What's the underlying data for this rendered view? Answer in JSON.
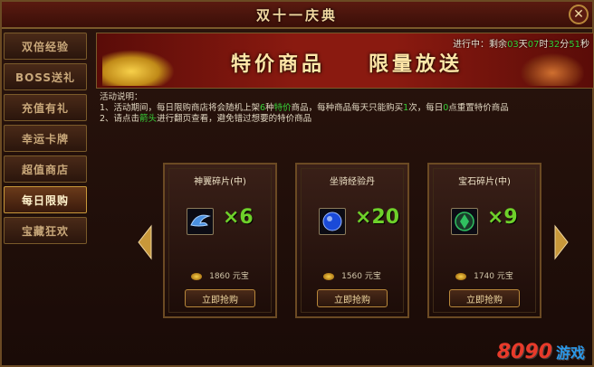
{
  "window": {
    "title": "双十一庆典"
  },
  "sidebar": {
    "items": [
      {
        "label": "双倍经验"
      },
      {
        "label": "BOSS送礼"
      },
      {
        "label": "充值有礼"
      },
      {
        "label": "幸运卡牌"
      },
      {
        "label": "超值商店"
      },
      {
        "label": "每日限购"
      },
      {
        "label": "宝藏狂欢"
      }
    ],
    "active_index": 5
  },
  "banner": {
    "title_left": "特价商品",
    "title_right": "限量放送",
    "countdown": {
      "prefix": "进行中：剩余",
      "days": "03",
      "days_unit": "天",
      "hours": "07",
      "hours_unit": "时",
      "minutes": "32",
      "minutes_unit": "分",
      "seconds": "51",
      "seconds_unit": "秒"
    }
  },
  "description": {
    "heading": "活动说明：",
    "line1_a": "1、活动期间，每日限购商店将会随机上架",
    "line1_count": "6",
    "line1_b": "种",
    "line1_hl": "特价",
    "line1_c": "商品，每种商品每天只能购买",
    "line1_times": "1",
    "line1_d": "次，每日",
    "line1_zero": "0",
    "line1_e": "点重置特价商品",
    "line2_a": "2、请点击",
    "line2_hl": "箭头",
    "line2_b": "进行翻页查看，避免错过想要的特价商品"
  },
  "products": [
    {
      "name": "神翼碎片(中)",
      "qty": "×6",
      "price": "1860",
      "currency": "元宝",
      "buy_label": "立即抢购",
      "icon": "wing-fragment-icon",
      "icon_color": "#4a90e0"
    },
    {
      "name": "坐骑经验丹",
      "qty": "×20",
      "price": "1560",
      "currency": "元宝",
      "buy_label": "立即抢购",
      "icon": "mount-exp-pill-icon",
      "icon_color": "#1a4ad8"
    },
    {
      "name": "宝石碎片(中)",
      "qty": "×9",
      "price": "1740",
      "currency": "元宝",
      "buy_label": "立即抢购",
      "icon": "gem-fragment-icon",
      "icon_color": "#30c060"
    }
  ],
  "colors": {
    "highlight": "#38d038",
    "gold": "#f0d7a0",
    "qty": "#6ed02a"
  },
  "watermark": {
    "brand": "8090",
    "suffix": "游戏"
  }
}
